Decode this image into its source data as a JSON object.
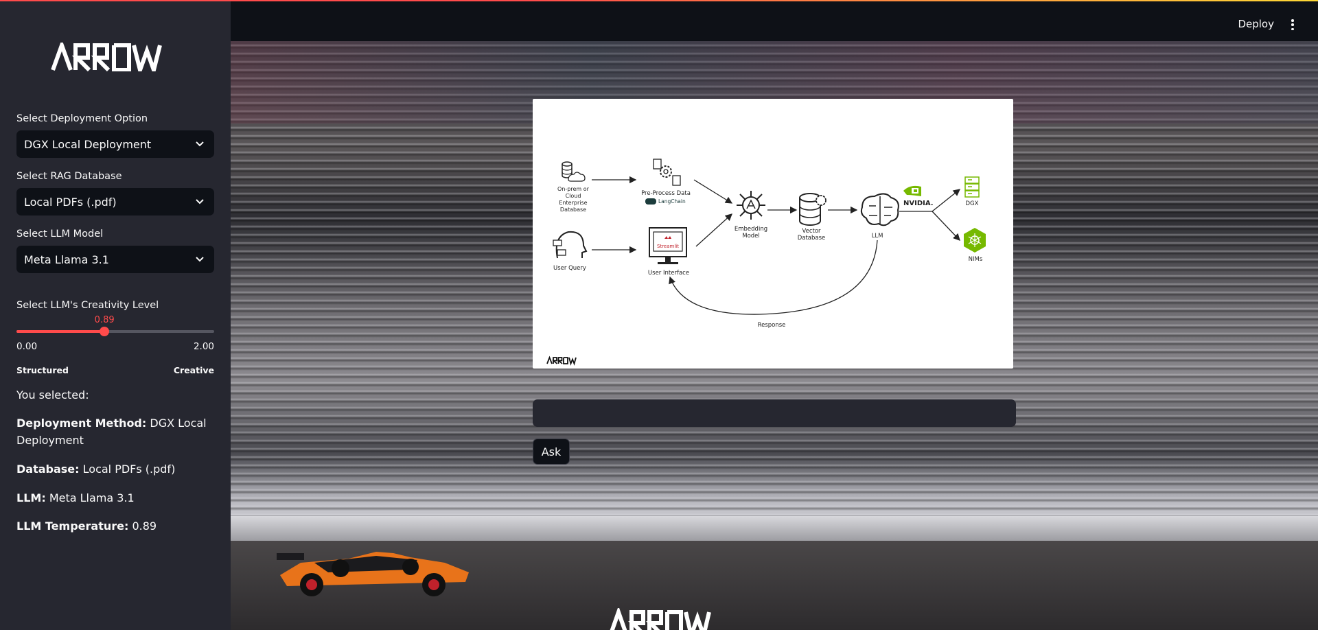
{
  "sidebar": {
    "logo_text": "ARROW",
    "deployment": {
      "label": "Select Deployment Option",
      "value": "DGX Local Deployment"
    },
    "database": {
      "label": "Select RAG Database",
      "value": "Local PDFs (.pdf)"
    },
    "llm": {
      "label": "Select LLM Model",
      "value": "Meta Llama 3.1"
    },
    "creativity": {
      "label": "Select LLM's Creativity Level",
      "value": 0.89,
      "value_text": "0.89",
      "min_text": "0.00",
      "max_text": "2.00",
      "min": 0,
      "max": 2,
      "left_hint": "Structured",
      "right_hint": "Creative"
    },
    "summary": {
      "intro": "You selected:",
      "deployment_key": "Deployment Method:",
      "deployment_val": "DGX Local Deployment",
      "database_key": "Database:",
      "database_val": "Local PDFs (.pdf)",
      "llm_key": "LLM:",
      "llm_val": "Meta Llama 3.1",
      "temp_key": "LLM Temperature:",
      "temp_val": "0.89"
    }
  },
  "header": {
    "deploy_label": "Deploy",
    "menu_icon": "kebab-menu-icon"
  },
  "diagram": {
    "source_label_1": "On-prem or",
    "source_label_2": "Cloud",
    "source_label_3": "Enterprise",
    "source_label_4": "Database",
    "preprocess_label": "Pre-Process Data",
    "langchain_label": "LangChain",
    "user_query_label": "User Query",
    "streamlit_label": "Streamlit",
    "user_interface_label": "User Interface",
    "embedding_label_1": "Embedding",
    "embedding_label_2": "Model",
    "vector_label_1": "Vector",
    "vector_label_2": "Database",
    "llm_label": "LLM",
    "nvidia_label": "NVIDIA.",
    "dgx_label": "DGX",
    "nims_label": "NIMs",
    "response_label": "Response",
    "footer_logo": "ARROW"
  },
  "query": {
    "placeholder": "",
    "value": "",
    "ask_label": "Ask"
  },
  "colors": {
    "accent": "#ff4b4b",
    "sidebar_bg": "#262730",
    "app_bg": "#0e1117",
    "nvidia_green": "#76b900"
  }
}
